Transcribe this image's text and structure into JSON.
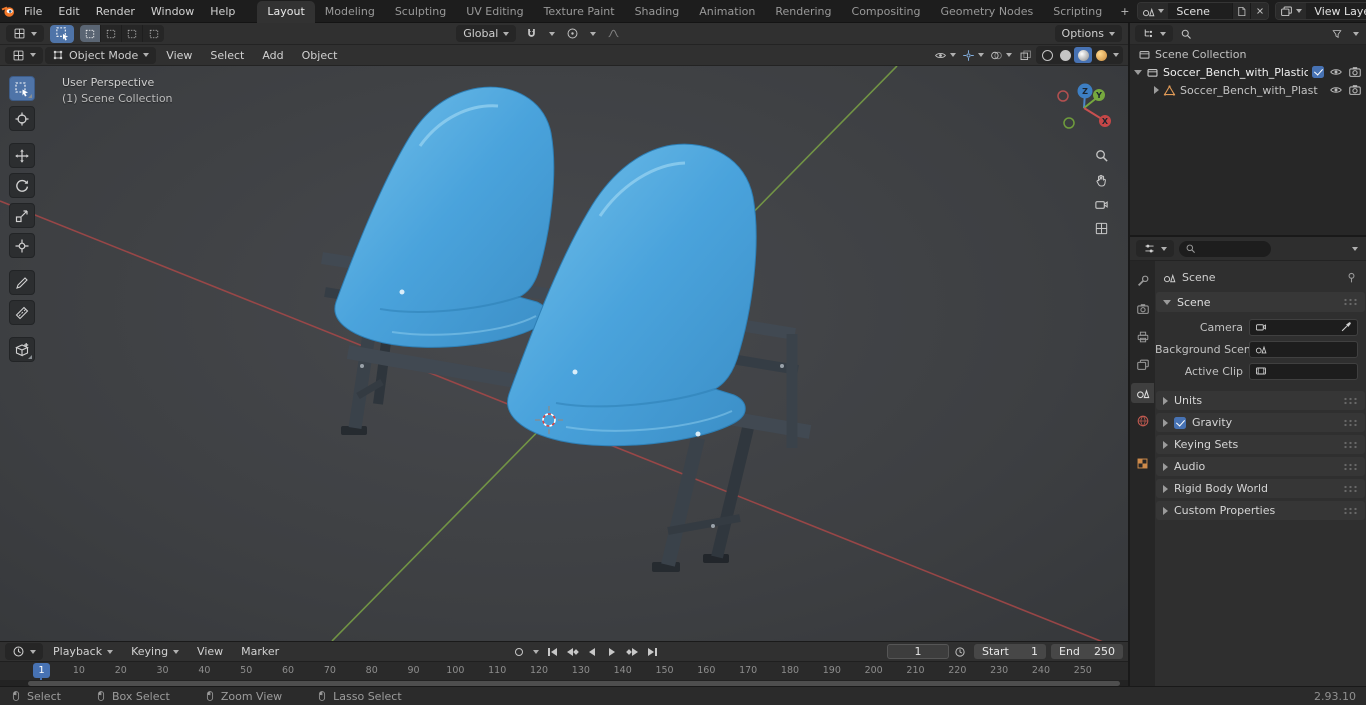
{
  "topbar": {
    "menus": [
      "File",
      "Edit",
      "Render",
      "Window",
      "Help"
    ],
    "workspaces": [
      "Layout",
      "Modeling",
      "Sculpting",
      "UV Editing",
      "Texture Paint",
      "Shading",
      "Animation",
      "Rendering",
      "Compositing",
      "Geometry Nodes",
      "Scripting"
    ],
    "active_workspace": "Layout",
    "add_tab": "+",
    "scene_value": "Scene",
    "view_layer_value": "View Layer"
  },
  "tools": {
    "orientation": "Global",
    "options": "Options"
  },
  "view_header": {
    "mode": "Object Mode",
    "menu_view": "View",
    "menu_select": "Select",
    "menu_add": "Add",
    "menu_object": "Object"
  },
  "viewport": {
    "perspective": "User Perspective",
    "collection": "(1) Scene Collection",
    "axis_x": "X",
    "axis_y": "Y",
    "axis_z": "Z"
  },
  "outliner": {
    "scene_collection": "Scene Collection",
    "object": "Soccer_Bench_with_Plastic_Sc",
    "mesh": "Soccer_Bench_with_Plast"
  },
  "properties": {
    "breadcrumb": "Scene",
    "panel_scene": "Scene",
    "field_camera": "Camera",
    "field_background": "Background Scene",
    "field_clip": "Active Clip",
    "panel_units": "Units",
    "panel_gravity": "Gravity",
    "gravity_enabled": true,
    "panel_keying": "Keying Sets",
    "panel_audio": "Audio",
    "panel_rigid": "Rigid Body World",
    "panel_custom": "Custom Properties"
  },
  "timeline": {
    "menu_playback": "Playback",
    "menu_keying": "Keying",
    "menu_view": "View",
    "menu_marker": "Marker",
    "current_frame": "1",
    "playhead": "1",
    "start_label": "Start",
    "start_value": "1",
    "end_label": "End",
    "end_value": "250",
    "ticks": [
      "10",
      "20",
      "30",
      "40",
      "50",
      "60",
      "70",
      "80",
      "90",
      "100",
      "110",
      "120",
      "130",
      "140",
      "150",
      "160",
      "170",
      "180",
      "190",
      "200",
      "210",
      "220",
      "230",
      "240",
      "250"
    ]
  },
  "status": {
    "select": "Select",
    "box_select": "Box Select",
    "zoom_view": "Zoom View",
    "lasso_select": "Lasso Select",
    "version": "2.93.10"
  },
  "colors": {
    "accent": "#4772b3",
    "chair_blue": "#4aa3dc",
    "axis_x_red": "#a84848",
    "axis_y_green": "#7ba345"
  }
}
